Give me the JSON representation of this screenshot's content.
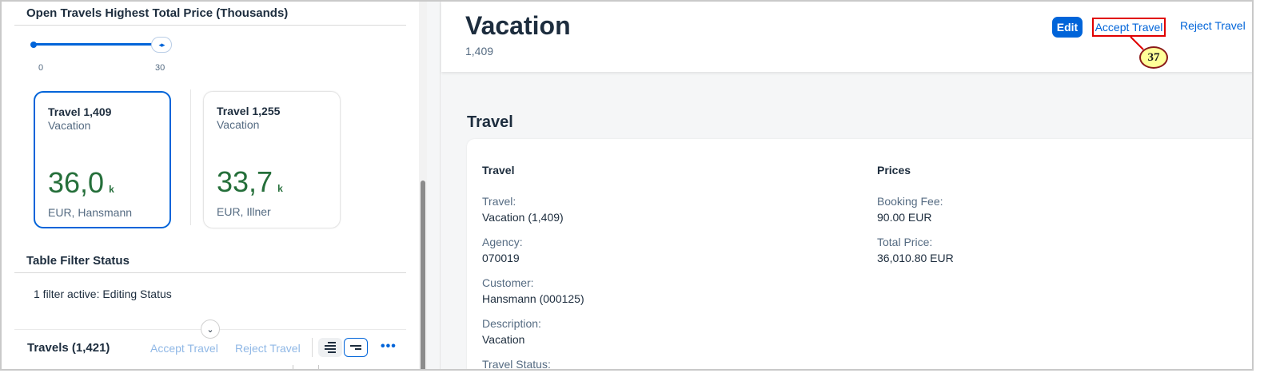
{
  "left_pane": {
    "chart_section_title": "Open Travels Highest Total Price (Thousands)",
    "slider": {
      "min_label": "0",
      "max_label": "30",
      "handle_glyph": "◂▸"
    },
    "cards": [
      {
        "title": "Travel 1,409",
        "subtitle": "Vacation",
        "value": "36,0",
        "unit": "k",
        "footer": "EUR, Hansmann",
        "selected": true
      },
      {
        "title": "Travel 1,255",
        "subtitle": "Vacation",
        "value": "33,7",
        "unit": "k",
        "footer": "EUR, Illner",
        "selected": false
      }
    ],
    "filter_section_title": "Table Filter Status",
    "filter_status": "1 filter active: Editing Status",
    "collapse_glyph": "⌄",
    "table_toolbar": {
      "title": "Travels (1,421)",
      "accept_label": "Accept Travel",
      "reject_label": "Reject Travel",
      "more_glyph": "•••"
    }
  },
  "object_page": {
    "title": "Vacation",
    "subtitle": "1,409",
    "edit_label": "Edit",
    "accept_label": "Accept Travel",
    "reject_label": "Reject Travel",
    "step_badge": "37",
    "section_title": "Travel",
    "groups": {
      "travel": {
        "title": "Travel",
        "fields": [
          {
            "label": "Travel:",
            "value": "Vacation (1,409)"
          },
          {
            "label": "Agency:",
            "value": "070019"
          },
          {
            "label": "Customer:",
            "value": "Hansmann (000125)"
          },
          {
            "label": "Description:",
            "value": "Vacation"
          },
          {
            "label": "Travel Status:",
            "value": ""
          }
        ]
      },
      "prices": {
        "title": "Prices",
        "fields": [
          {
            "label": "Booking Fee:",
            "value": "90.00 EUR"
          },
          {
            "label": "Total Price:",
            "value": "36,010.80 EUR"
          }
        ]
      }
    }
  },
  "colors": {
    "brand_blue": "#0064d9",
    "kpi_green": "#256f3a",
    "highlight_red": "#e00000",
    "badge_yellow": "#ffff99"
  }
}
